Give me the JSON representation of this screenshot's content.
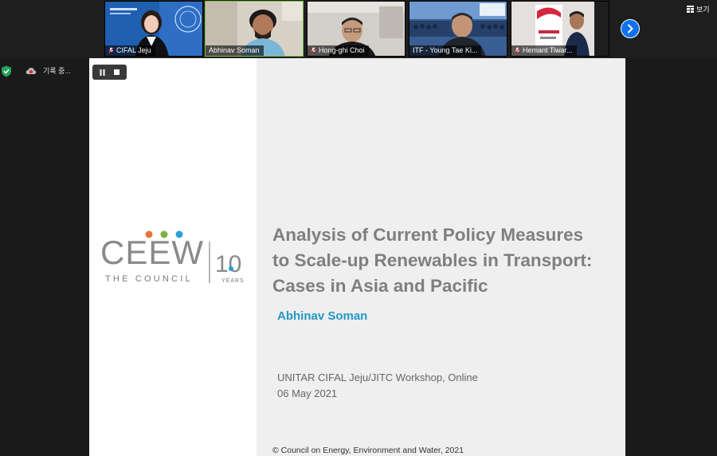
{
  "participants": [
    {
      "name": "CIFAL Jeju",
      "muted": true
    },
    {
      "name": "Abhinav Soman",
      "muted": false
    },
    {
      "name": "Hong-ghi Choi",
      "muted": true
    },
    {
      "name": "ITF - Young Tae Ki...",
      "muted": true
    },
    {
      "name": "Hemant Tiwar...",
      "muted": true
    }
  ],
  "toolbar": {
    "view_label": "보기",
    "recording_label": "기록 중..."
  },
  "slide": {
    "logo_text": "CEEW",
    "logo_subtitle": "THE COUNCIL",
    "logo_anniversary": "10",
    "logo_years": "YEARS",
    "title_line1": "Analysis of Current Policy Measures",
    "title_line2": "to Scale-up Renewables in Transport:",
    "title_line3": "Cases in Asia and Pacific",
    "author": "Abhinav Soman",
    "event": "UNITAR CIFAL Jeju/JITC Workshop, Online",
    "date": "06 May 2021",
    "copyright": "© Council on Energy, Environment and Water, 2021"
  },
  "colors": {
    "accent_blue": "#0e72ed",
    "title_gray": "#7f7f7f",
    "author_blue": "#2497c4",
    "dot_orange": "#e8733a",
    "dot_green": "#7bb342",
    "dot_blue": "#2a9fd6"
  },
  "icons": {
    "mic_muted": "mic-muted-icon",
    "next": "chevron-right-icon",
    "view": "grid-view-icon",
    "security": "shield-check-icon",
    "record": "cloud-record-icon",
    "pause": "pause-icon",
    "stop": "stop-icon"
  }
}
